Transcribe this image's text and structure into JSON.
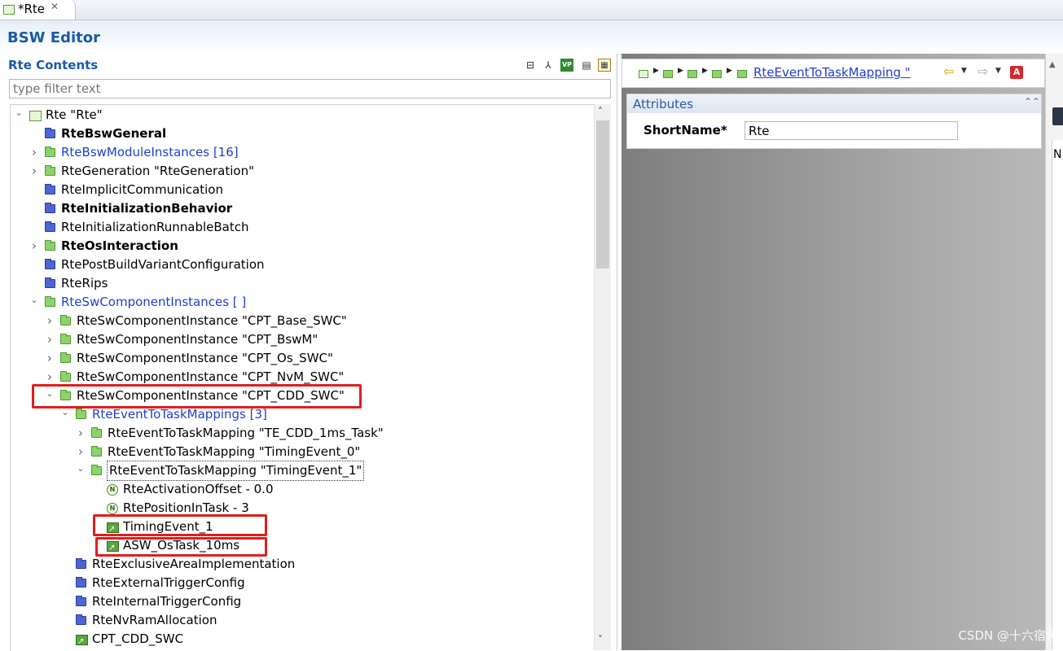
{
  "tab": {
    "label": "*Rte",
    "close": "✕"
  },
  "editor": {
    "title": "BSW Editor"
  },
  "left_panel": {
    "title": "Rte Contents",
    "filter_placeholder": "type filter text",
    "toolbar": [
      "collapse-all-icon",
      "link-icon",
      "variant-icon",
      "document-icon",
      "grid-icon"
    ],
    "toolbar_variant_text": "VP",
    "tree": [
      {
        "label": "Rte \"Rte\"",
        "toggle": "expanded",
        "icon": "rte",
        "style": ""
      },
      {
        "label": "RteBswGeneral",
        "toggle": "none",
        "icon": "bfolder",
        "style": "bold"
      },
      {
        "label": "RteBswModuleInstances [16]",
        "toggle": "collapsed",
        "icon": "folder",
        "style": "blue"
      },
      {
        "label": "RteGeneration \"RteGeneration\"",
        "toggle": "collapsed",
        "icon": "folder",
        "style": ""
      },
      {
        "label": "RteImplicitCommunication",
        "toggle": "none",
        "icon": "bfolder",
        "style": ""
      },
      {
        "label": "RteInitializationBehavior",
        "toggle": "none",
        "icon": "bfolder",
        "style": "bold"
      },
      {
        "label": "RteInitializationRunnableBatch",
        "toggle": "none",
        "icon": "bfolder",
        "style": ""
      },
      {
        "label": "RteOsInteraction",
        "toggle": "collapsed",
        "icon": "folder",
        "style": "bold"
      },
      {
        "label": "RtePostBuildVariantConfiguration",
        "toggle": "none",
        "icon": "bfolder",
        "style": ""
      },
      {
        "label": "RteRips",
        "toggle": "none",
        "icon": "bfolder",
        "style": ""
      },
      {
        "label": "RteSwComponentInstances [  ]",
        "toggle": "expanded",
        "icon": "folder",
        "style": "blue"
      },
      {
        "label": "RteSwComponentInstance \"CPT_Base_SWC\"",
        "toggle": "collapsed",
        "icon": "folder",
        "style": ""
      },
      {
        "label": "RteSwComponentInstance \"CPT_BswM\"",
        "toggle": "collapsed",
        "icon": "folder",
        "style": ""
      },
      {
        "label": "RteSwComponentInstance \"CPT_Os_SWC\"",
        "toggle": "collapsed",
        "icon": "folder",
        "style": ""
      },
      {
        "label": "RteSwComponentInstance \"CPT_NvM_SWC\"",
        "toggle": "collapsed",
        "icon": "folder",
        "style": ""
      },
      {
        "label": "RteSwComponentInstance \"CPT_CDD_SWC\"",
        "toggle": "expanded",
        "icon": "folder",
        "style": ""
      },
      {
        "label": "RteEventToTaskMappings [3]",
        "toggle": "expanded",
        "icon": "folder",
        "style": "blue"
      },
      {
        "label": "RteEventToTaskMapping \"TE_CDD_1ms_Task\"",
        "toggle": "collapsed",
        "icon": "folder",
        "style": ""
      },
      {
        "label": "RteEventToTaskMapping \"TimingEvent_0\"",
        "toggle": "collapsed",
        "icon": "folder",
        "style": ""
      },
      {
        "label": "RteEventToTaskMapping \"TimingEvent_1\"",
        "toggle": "expanded",
        "icon": "folder",
        "style": "focus"
      },
      {
        "label": "RteActivationOffset - 0.0",
        "toggle": "none",
        "icon": "param",
        "style": ""
      },
      {
        "label": "RtePositionInTask - 3",
        "toggle": "none",
        "icon": "param",
        "style": ""
      },
      {
        "label": "TimingEvent_1",
        "toggle": "none",
        "icon": "ref",
        "style": ""
      },
      {
        "label": "ASW_OsTask_10ms",
        "toggle": "none",
        "icon": "ref",
        "style": ""
      },
      {
        "label": "RteExclusiveAreaImplementation",
        "toggle": "none",
        "icon": "bfolder",
        "style": ""
      },
      {
        "label": "RteExternalTriggerConfig",
        "toggle": "none",
        "icon": "bfolder",
        "style": ""
      },
      {
        "label": "RteInternalTriggerConfig",
        "toggle": "none",
        "icon": "bfolder",
        "style": ""
      },
      {
        "label": "RteNvRamAllocation",
        "toggle": "none",
        "icon": "bfolder",
        "style": ""
      },
      {
        "label": "CPT_CDD_SWC",
        "toggle": "none",
        "icon": "ref",
        "style": ""
      }
    ]
  },
  "right_panel": {
    "breadcrumb_link": "RteEventToTaskMapping \"",
    "attributes_title": "Attributes",
    "shortname_label": "ShortName*",
    "shortname_value": "Rte",
    "nav_a_label": "A"
  },
  "far_panel": {
    "letter": "N"
  },
  "watermark": "CSDN @十六宿舍",
  "colors": {
    "accent": "#1b5aa6",
    "link": "#1f3fd0",
    "highlight": "#e01e1e",
    "folder": "#8bd36a"
  }
}
